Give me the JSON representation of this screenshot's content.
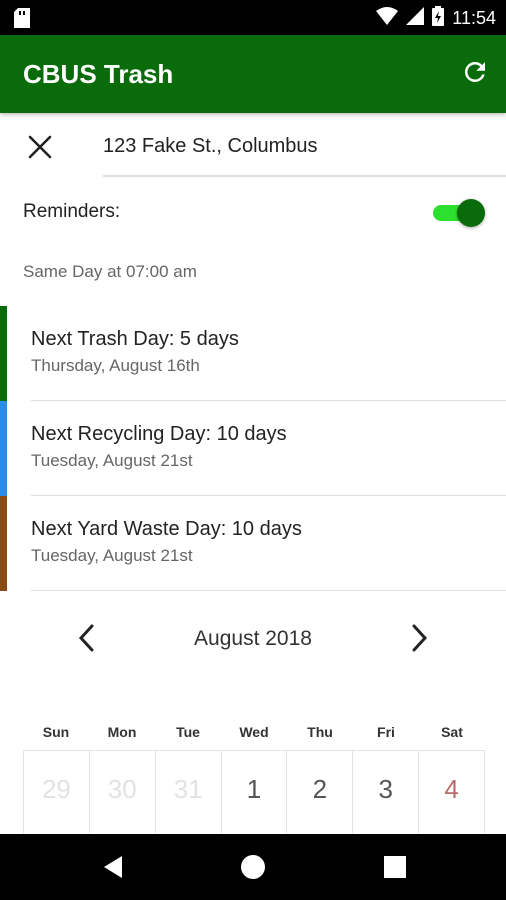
{
  "status_bar": {
    "time": "11:54"
  },
  "app_bar": {
    "title": "CBUS Trash"
  },
  "address": {
    "value": "123 Fake St., Columbus"
  },
  "reminders": {
    "label": "Reminders:",
    "enabled": true,
    "time_text": "Same Day at 07:00 am"
  },
  "pickups": [
    {
      "title": "Next Trash Day: 5 days",
      "date": "Thursday, August 16th",
      "color": "#0a6b0a"
    },
    {
      "title": "Next Recycling Day: 10 days",
      "date": "Tuesday, August 21st",
      "color": "#2a8ee6"
    },
    {
      "title": "Next Yard Waste Day: 10 days",
      "date": "Tuesday, August 21st",
      "color": "#8a4a14"
    }
  ],
  "calendar": {
    "month": "August 2018",
    "weekdays": [
      "Sun",
      "Mon",
      "Tue",
      "Wed",
      "Thu",
      "Fri",
      "Sat"
    ],
    "days": [
      "29",
      "30",
      "31",
      "1",
      "2",
      "3",
      "4"
    ]
  },
  "colors": {
    "primary": "#0a6b0a",
    "accent": "#2ee02e"
  }
}
